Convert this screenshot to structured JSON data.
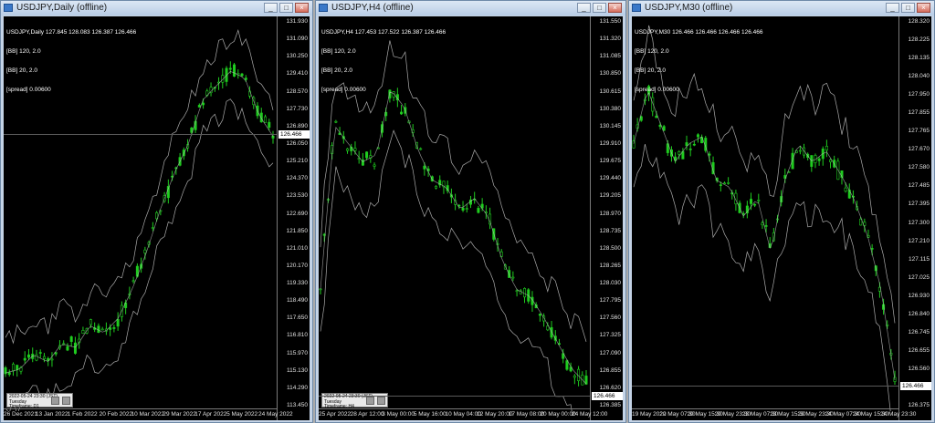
{
  "windows": [
    {
      "id": "daily",
      "title": "USDJPY,Daily (offline)",
      "ohlc_line": "USDJPY,Daily  127.845 128.083 126.387 126.466",
      "info_lines": [
        "[BB] 120, 2.0",
        "[BB] 20, 2.0",
        "[spread] 0.00600"
      ],
      "price_ticks": [
        "131.930",
        "131.090",
        "130.250",
        "129.410",
        "128.570",
        "127.730",
        "126.890",
        "126.050",
        "125.210",
        "124.370",
        "123.530",
        "122.690",
        "121.850",
        "121.010",
        "120.170",
        "119.330",
        "118.490",
        "117.650",
        "116.810",
        "115.970",
        "115.130",
        "114.290",
        "113.450"
      ],
      "current_price": "126.466",
      "time_ticks": [
        "26 Dec 2021",
        "13 Jan 2022",
        "1 Feb 2022",
        "20 Feb 2022",
        "10 Mar 2022",
        "29 Mar 2022",
        "17 Apr 2022",
        "5 May 2022",
        "24 May 2022"
      ],
      "panel": {
        "line1": "2022-05-24 23:30 (JST)",
        "line2": "Tuesday",
        "line3": "Timeframe: D1"
      }
    },
    {
      "id": "h4",
      "title": "USDJPY,H4 (offline)",
      "ohlc_line": "USDJPY,H4  127.453 127.522 126.387 126.466",
      "info_lines": [
        "[BB] 120, 2.0",
        "[BB] 20, 2.0",
        "[spread] 0.00600"
      ],
      "price_ticks": [
        "131.550",
        "131.320",
        "131.085",
        "130.850",
        "130.615",
        "130.380",
        "130.145",
        "129.910",
        "129.675",
        "129.440",
        "129.205",
        "128.970",
        "128.735",
        "128.500",
        "128.265",
        "128.030",
        "127.795",
        "127.560",
        "127.325",
        "127.090",
        "126.855",
        "126.620",
        "126.385"
      ],
      "current_price": "126.466",
      "time_ticks": [
        "25 Apr 2022",
        "28 Apr 12:00",
        "3 May 00:00",
        "5 May 16:00",
        "10 May 04:00",
        "12 May 20:00",
        "17 May 08:00",
        "20 May 00:00",
        "24 May 12:00"
      ],
      "panel": {
        "line1": "2022-05-24 23:30 (JST)",
        "line2": "Tuesday",
        "line3": "Timeframe: H4"
      }
    },
    {
      "id": "m30",
      "title": "USDJPY,M30 (offline)",
      "ohlc_line": "USDJPY,M30  126.466 126.466 126.466 126.466",
      "info_lines": [
        "[BB] 120, 2.0",
        "[BB] 20, 2.0",
        "[spread] 0.00600"
      ],
      "price_ticks": [
        "128.320",
        "128.225",
        "128.135",
        "128.040",
        "127.950",
        "127.855",
        "127.765",
        "127.670",
        "127.580",
        "127.485",
        "127.395",
        "127.300",
        "127.210",
        "127.115",
        "127.025",
        "126.930",
        "126.840",
        "126.745",
        "126.655",
        "126.560",
        "126.466",
        "126.375"
      ],
      "current_price": "126.466",
      "time_ticks": [
        "19 May 2022",
        "20 May 07:30",
        "20 May 15:30",
        "20 May 23:30",
        "23 May 07:30",
        "23 May 15:30",
        "23 May 23:30",
        "24 May 07:30",
        "24 May 15:30",
        "24 May 23:30"
      ],
      "panel": null
    }
  ],
  "colors": {
    "candle": "#1fcc1f",
    "band": "#bdbdbd",
    "background": "#000000"
  },
  "window_controls": {
    "minimize": "_",
    "maximize": "□",
    "close": "×"
  }
}
